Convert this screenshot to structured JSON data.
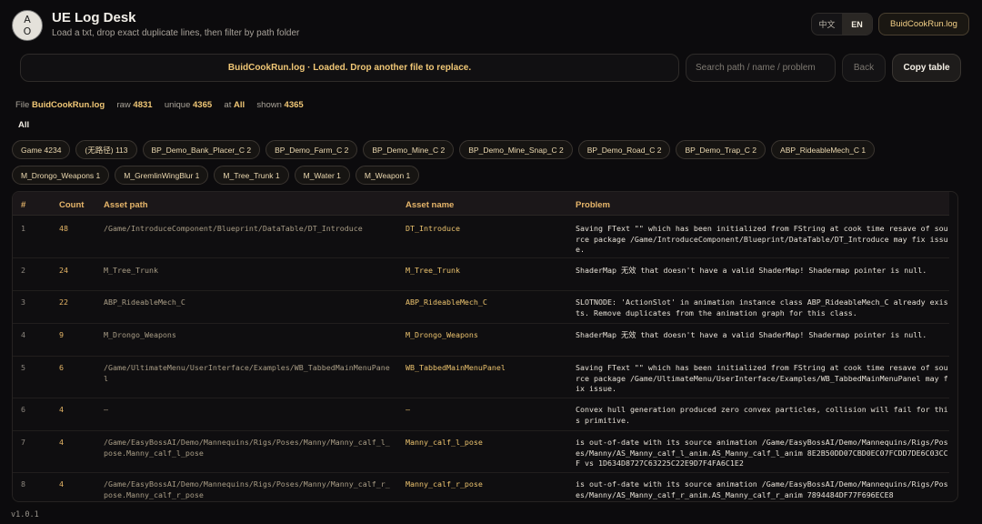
{
  "app": {
    "logo_top": "A",
    "logo_bottom": "O",
    "title": "UE Log Desk",
    "subtitle": "Load a txt, drop exact duplicate lines, then filter by path folder"
  },
  "header": {
    "lang_zh": "中文",
    "lang_en": "EN",
    "active_lang": "EN",
    "file_chip": "BuidCookRun.log"
  },
  "toolbar": {
    "drop_zone_text": "BuidCookRun.log · Loaded. Drop another file to replace.",
    "search_placeholder": "Search path / name / problem",
    "search_value": "",
    "back_label": "Back",
    "copy_label": "Copy table"
  },
  "stats": {
    "file_label": "File",
    "file_value": "BuidCookRun.log",
    "raw_label": "raw",
    "raw_value": "4831",
    "unique_label": "unique",
    "unique_value": "4365",
    "at_label": "at",
    "at_value": "All",
    "shown_label": "shown",
    "shown_value": "4365"
  },
  "filter": {
    "all_label": "All",
    "folders": [
      "Game 4234",
      "(无路径) 113",
      "BP_Demo_Bank_Placer_C 2",
      "BP_Demo_Farm_C 2",
      "BP_Demo_Mine_C 2",
      "BP_Demo_Mine_Snap_C 2",
      "BP_Demo_Road_C 2",
      "BP_Demo_Trap_C 2",
      "ABP_RideableMech_C 1",
      "M_Drongo_Weapons 1",
      "M_GremlinWingBlur 1",
      "M_Tree_Trunk 1",
      "M_Water 1",
      "M_Weapon 1"
    ]
  },
  "table": {
    "columns": {
      "num": "#",
      "count": "Count",
      "path": "Asset path",
      "name": "Asset name",
      "problem": "Problem"
    },
    "rows": [
      {
        "num": "1",
        "count": "48",
        "path": "/Game/IntroduceComponent/Blueprint/DataTable/DT_Introduce",
        "name": "DT_Introduce",
        "problem": "Saving FText \"\" which has been initialized from FString at cook time resave of source package /Game/IntroduceComponent/Blueprint/DataTable/DT_Introduce may fix issue."
      },
      {
        "num": "2",
        "count": "24",
        "path": "M_Tree_Trunk",
        "name": "M_Tree_Trunk",
        "problem": "ShaderMap 无效 that doesn't have a valid ShaderMap! Shadermap pointer is null."
      },
      {
        "num": "3",
        "count": "22",
        "path": "ABP_RideableMech_C",
        "name": "ABP_RideableMech_C",
        "problem": "SLOTNODE: 'ActionSlot' in animation instance class ABP_RideableMech_C already exists. Remove duplicates from the animation graph for this class."
      },
      {
        "num": "4",
        "count": "9",
        "path": "M_Drongo_Weapons",
        "name": "M_Drongo_Weapons",
        "problem": "ShaderMap 无效 that doesn't have a valid ShaderMap! Shadermap pointer is null."
      },
      {
        "num": "5",
        "count": "6",
        "path": "/Game/UltimateMenu/UserInterface/Examples/WB_TabbedMainMenuPanel",
        "name": "WB_TabbedMainMenuPanel",
        "problem": "Saving FText \"\" which has been initialized from FString at cook time resave of source package /Game/UltimateMenu/UserInterface/Examples/WB_TabbedMainMenuPanel may fix issue."
      },
      {
        "num": "6",
        "count": "4",
        "path": "—",
        "name": "—",
        "problem": "Convex hull generation produced zero convex particles, collision will fail for this primitive."
      },
      {
        "num": "7",
        "count": "4",
        "path": "/Game/EasyBossAI/Demo/Mannequins/Rigs/Poses/Manny/Manny_calf_l_pose.Manny_calf_l_pose",
        "name": "Manny_calf_l_pose",
        "problem": "is out-of-date with its source animation /Game/EasyBossAI/Demo/Mannequins/Rigs/Poses/Manny/AS_Manny_calf_l_anim.AS_Manny_calf_l_anim 8E2B50DD07CBD0EC07FCDD7DE6C03CCF vs 1D634D8727C63225C22E9D7F4FA6C1E2"
      },
      {
        "num": "8",
        "count": "4",
        "path": "/Game/EasyBossAI/Demo/Mannequins/Rigs/Poses/Manny/Manny_calf_r_pose.Manny_calf_r_pose",
        "name": "Manny_calf_r_pose",
        "problem": "is out-of-date with its source animation /Game/EasyBossAI/Demo/Mannequins/Rigs/Poses/Manny/AS_Manny_calf_r_anim.AS_Manny_calf_r_anim 7894484DF77F696ECE8"
      }
    ]
  },
  "footer": {
    "version": "v1.0.1"
  }
}
